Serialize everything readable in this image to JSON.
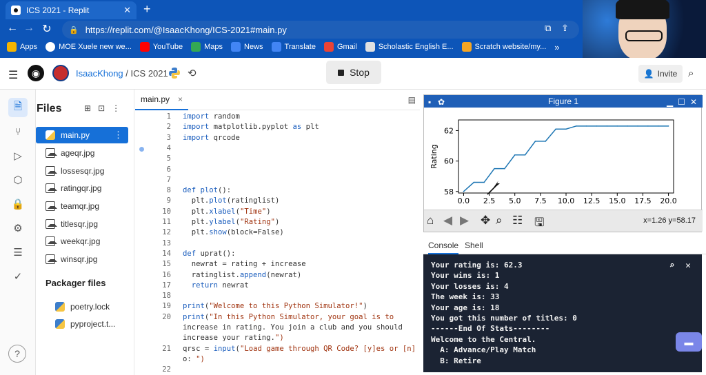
{
  "browser": {
    "tab_title": "ICS 2021 - Replit",
    "url": "https://replit.com/@IsaacKhong/ICS-2021#main.py",
    "bookmarks": [
      {
        "label": "Apps",
        "color": "#f4b400"
      },
      {
        "label": "MOE Xuele new we...",
        "color": "#ffffff"
      },
      {
        "label": "YouTube",
        "color": "#ff0000"
      },
      {
        "label": "Maps",
        "color": "#34a853"
      },
      {
        "label": "News",
        "color": "#4285f4"
      },
      {
        "label": "Translate",
        "color": "#4285f4"
      },
      {
        "label": "Gmail",
        "color": "#ea4335"
      },
      {
        "label": "Scholastic English E...",
        "color": "#e0e0e0"
      },
      {
        "label": "Scratch website/my...",
        "color": "#f6a623"
      }
    ]
  },
  "header": {
    "user": "IsaacKhong",
    "separator": "/",
    "project": "ICS 2021",
    "stop_label": "Stop",
    "invite_label": "Invite"
  },
  "files": {
    "title": "Files",
    "items": [
      {
        "name": "main.py",
        "type": "py"
      },
      {
        "name": "ageqr.jpg",
        "type": "img"
      },
      {
        "name": "lossesqr.jpg",
        "type": "img"
      },
      {
        "name": "ratingqr.jpg",
        "type": "img"
      },
      {
        "name": "teamqr.jpg",
        "type": "img"
      },
      {
        "name": "titlesqr.jpg",
        "type": "img"
      },
      {
        "name": "weekqr.jpg",
        "type": "img"
      },
      {
        "name": "winsqr.jpg",
        "type": "img"
      }
    ],
    "packager_title": "Packager files",
    "packager_items": [
      "poetry.lock",
      "pyproject.t..."
    ]
  },
  "editor": {
    "tab": "main.py",
    "lines": [
      {
        "n": "1",
        "t": "import random"
      },
      {
        "n": "2",
        "t": "import matplotlib.pyplot as plt"
      },
      {
        "n": "3",
        "t": "import qrcode"
      },
      {
        "n": "4",
        "t": ""
      },
      {
        "n": "5",
        "t": ""
      },
      {
        "n": "6",
        "t": ""
      },
      {
        "n": "7",
        "t": ""
      },
      {
        "n": "8",
        "t": "def plot():"
      },
      {
        "n": "9",
        "t": "  plt.plot(ratinglist)"
      },
      {
        "n": "10",
        "t": "  plt.xlabel(\"Time\")"
      },
      {
        "n": "11",
        "t": "  plt.ylabel(\"Rating\")"
      },
      {
        "n": "12",
        "t": "  plt.show(block=False)"
      },
      {
        "n": "13",
        "t": ""
      },
      {
        "n": "14",
        "t": "def uprat():"
      },
      {
        "n": "15",
        "t": "  newrat = rating + increase"
      },
      {
        "n": "16",
        "t": "  ratinglist.append(newrat)"
      },
      {
        "n": "17",
        "t": "  return newrat"
      },
      {
        "n": "18",
        "t": ""
      },
      {
        "n": "19",
        "t": "print(\"Welcome to this Python Simulator!\")"
      },
      {
        "n": "20",
        "t": "print(\"In this Python Simulator, your goal is to"
      },
      {
        "n": "",
        "t": "increase in rating. You join a club and you should"
      },
      {
        "n": "",
        "t": "increase your rating.\")"
      },
      {
        "n": "21",
        "t": "qrsc = input(\"Load game through QR Code? [y]es or [n]"
      },
      {
        "n": "",
        "t": "o: \")"
      },
      {
        "n": "22",
        "t": ""
      }
    ]
  },
  "figure": {
    "title": "Figure 1",
    "coords": "x=1.26 y=58.17"
  },
  "chart_data": {
    "type": "line",
    "title": "",
    "xlabel": "",
    "ylabel": "Rating",
    "xlim": [
      -0.5,
      20.5
    ],
    "ylim": [
      57.9,
      62.7
    ],
    "xticks": [
      "0.0",
      "2.5",
      "5.0",
      "7.5",
      "10.0",
      "12.5",
      "15.0",
      "17.5",
      "20.0"
    ],
    "yticks": [
      "58",
      "60",
      "62"
    ],
    "grid": false,
    "series": [
      {
        "color": "#1f77b4",
        "x": [
          0,
          1,
          2,
          3,
          4,
          5,
          6,
          7,
          8,
          9,
          10,
          11,
          12,
          13,
          14,
          15,
          16,
          17,
          18,
          19,
          20
        ],
        "y": [
          58.0,
          58.6,
          58.6,
          59.5,
          59.5,
          60.4,
          60.4,
          61.3,
          61.3,
          62.1,
          62.1,
          62.3,
          62.3,
          62.3,
          62.3,
          62.3,
          62.3,
          62.3,
          62.3,
          62.3,
          62.3
        ]
      }
    ]
  },
  "console": {
    "tabs": [
      "Console",
      "Shell"
    ],
    "lines": [
      "Your rating is: 62.3",
      "Your wins is: 1",
      "Your losses is: 4",
      "The week is: 33",
      "Your age is: 18",
      "You got this number of titles: 0",
      "------End Of Stats--------",
      "Welcome to the Central.",
      "  A: Advance/Play Match",
      "  B: Retire"
    ]
  }
}
